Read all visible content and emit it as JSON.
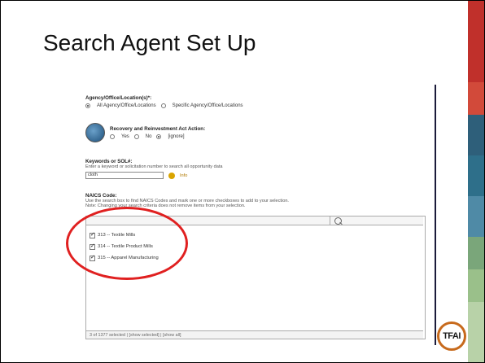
{
  "slide": {
    "title": "Search Agent Set Up"
  },
  "sidebar_colors": [
    "#c0302b",
    "#c0302b",
    "#d24a3a",
    "#2e5f7a",
    "#2e6f8a",
    "#4f8aa6",
    "#7aa67a",
    "#9ac08a",
    "#b8d2a8"
  ],
  "form": {
    "agency_label": "Agency/Office/Location(s)*:",
    "agency_all": "All Agency/Office/Locations",
    "agency_specific": "Specific Agency/Office/Locations",
    "recovery_label": "Recovery and Reinvestment Act Action:",
    "recovery_yes": "Yes",
    "recovery_no": "No",
    "recovery_ignore": "[ignore]",
    "keywords_label": "Keywords or SOL#:",
    "keywords_help": "Enter a keyword or solicitation number to search all opportunity data",
    "keywords_value": "cloth",
    "keywords_info": "Info",
    "naics_label": "NAICS Code:",
    "naics_help1": "Use the search box to find NAICS Codes and mark one or more checkboxes to add to your selection.",
    "naics_help2": "Note: Changing your search criteria does not remove items from your selection.",
    "naics_items": [
      {
        "label": "313 -- Textile Mills",
        "checked": true
      },
      {
        "label": "314 -- Textile Product Mills",
        "checked": true
      },
      {
        "label": "315 -- Apparel Manufacturing",
        "checked": true
      }
    ],
    "naics_footer": "3 of 1377 selected | [show selected] | [show all]"
  },
  "logo": {
    "text": "TFAI"
  }
}
